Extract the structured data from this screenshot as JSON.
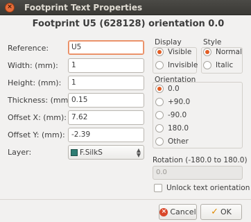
{
  "window": {
    "title": "Footprint Text Properties",
    "close_icon": "close-icon"
  },
  "header": {
    "title": "Footprint U5 (628128) orientation 0.0"
  },
  "form": {
    "reference": {
      "label": "Reference:",
      "value": "U5"
    },
    "width": {
      "label": "Width: (mm):",
      "value": "1"
    },
    "height": {
      "label": "Height: (mm):",
      "value": "1"
    },
    "thickness": {
      "label": "Thickness: (mm):",
      "value": "0.15"
    },
    "offset_x": {
      "label": "Offset X: (mm):",
      "value": "7.62"
    },
    "offset_y": {
      "label": "Offset Y: (mm):",
      "value": "-2.39"
    },
    "layer": {
      "label": "Layer:",
      "value": "F.SilkS",
      "swatch_color": "#2e7d73"
    }
  },
  "display": {
    "title": "Display",
    "options": [
      {
        "label": "Visible",
        "selected": true
      },
      {
        "label": "Invisible",
        "selected": false
      }
    ]
  },
  "style": {
    "title": "Style",
    "options": [
      {
        "label": "Normal",
        "selected": true
      },
      {
        "label": "Italic",
        "selected": false
      }
    ]
  },
  "orientation": {
    "title": "Orientation",
    "options": [
      {
        "label": "0.0",
        "selected": true
      },
      {
        "label": "+90.0",
        "selected": false
      },
      {
        "label": "-90.0",
        "selected": false
      },
      {
        "label": "180.0",
        "selected": false
      },
      {
        "label": "Other",
        "selected": false
      }
    ]
  },
  "rotation": {
    "label": "Rotation (-180.0 to 180.0)",
    "value": "0.0"
  },
  "unlock": {
    "label": "Unlock text orientation",
    "checked": false
  },
  "buttons": {
    "cancel": "Cancel",
    "ok": "OK"
  },
  "colors": {
    "accent": "#e25d24",
    "titlebar": "#3f3e3a"
  }
}
